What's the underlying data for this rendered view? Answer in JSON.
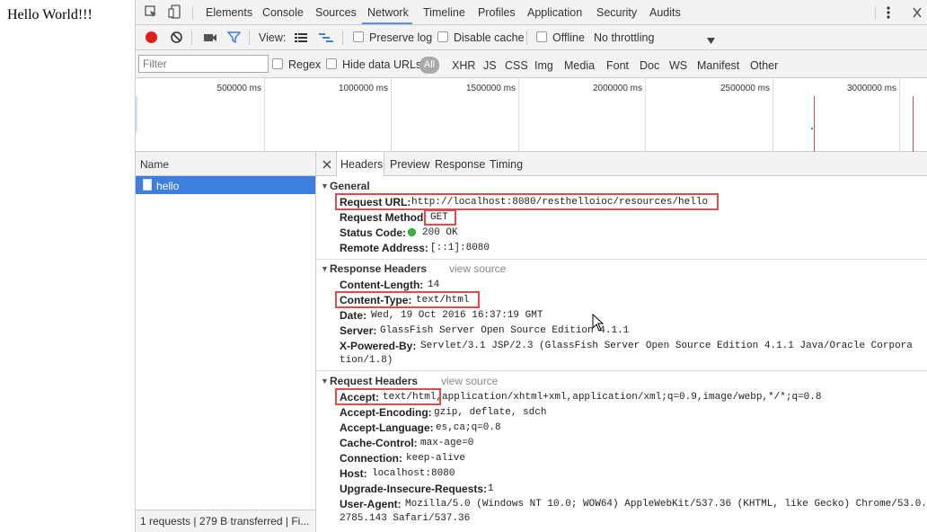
{
  "page": {
    "text": "Hello World!!!"
  },
  "devtools": {
    "tabs": [
      "Elements",
      "Console",
      "Sources",
      "Network",
      "Timeline",
      "Profiles",
      "Application",
      "Security",
      "Audits"
    ],
    "active_tab": "Network",
    "toolbar": {
      "view_label": "View:",
      "preserve_log": "Preserve log",
      "disable_cache": "Disable cache",
      "offline": "Offline",
      "throttle": "No throttling"
    },
    "filter": {
      "placeholder": "Filter",
      "regex": "Regex",
      "hide_data_urls": "Hide data URLs",
      "all": "All",
      "types": [
        "XHR",
        "JS",
        "CSS",
        "Img",
        "Media",
        "Font",
        "Doc",
        "WS",
        "Manifest",
        "Other"
      ]
    },
    "overview_ticks": [
      "500000 ms",
      "1000000 ms",
      "1500000 ms",
      "2000000 ms",
      "2500000 ms",
      "3000000 ms"
    ],
    "requests": {
      "column": "Name",
      "items": [
        "hello"
      ],
      "status": "1 requests  |  279 B transferred  |  Fi..."
    },
    "detail": {
      "tabs": [
        "Headers",
        "Preview",
        "Response",
        "Timing"
      ],
      "active_tab": "Headers",
      "general": {
        "title": "General",
        "rows": [
          {
            "k": "Request URL:",
            "v": "http://localhost:8080/resthelloioc/resources/hello"
          },
          {
            "k": "Request Method:",
            "v": "GET"
          },
          {
            "k": "Status Code:",
            "v": "200 OK"
          },
          {
            "k": "Remote Address:",
            "v": "[::1]:8080"
          }
        ]
      },
      "response_headers": {
        "title": "Response Headers",
        "view_source": "view source",
        "rows": [
          {
            "k": "Content-Length:",
            "v": "14"
          },
          {
            "k": "Content-Type:",
            "v": "text/html"
          },
          {
            "k": "Date:",
            "v": "Wed, 19 Oct 2016 16:37:19 GMT"
          },
          {
            "k": "Server:",
            "v": "GlassFish Server Open Source Edition  4.1.1"
          },
          {
            "k": "X-Powered-By:",
            "v": "Servlet/3.1 JSP/2.3 (GlassFish Server Open Source Edition  4.1.1  Java/Oracle Corpora",
            "v2": "tion/1.8)"
          }
        ]
      },
      "request_headers": {
        "title": "Request Headers",
        "view_source": "view source",
        "rows": [
          {
            "k": "Accept:",
            "v": "text/html,application/xhtml+xml,application/xml;q=0.9,image/webp,*/*;q=0.8"
          },
          {
            "k": "Accept-Encoding:",
            "v": "gzip, deflate, sdch"
          },
          {
            "k": "Accept-Language:",
            "v": "es,ca;q=0.8"
          },
          {
            "k": "Cache-Control:",
            "v": "max-age=0"
          },
          {
            "k": "Connection:",
            "v": "keep-alive"
          },
          {
            "k": "Host:",
            "v": "localhost:8080"
          },
          {
            "k": "Upgrade-Insecure-Requests:",
            "v": "1"
          },
          {
            "k": "User-Agent:",
            "v": "Mozilla/5.0 (Windows NT 10.0; WOW64) AppleWebKit/537.36 (KHTML, like Gecko) Chrome/53.0.",
            "v2": "2785.143 Safari/537.36"
          }
        ]
      }
    },
    "colors": {
      "accent": "#3d7fde",
      "highlight": "#e24b4b",
      "record": "#e0201a",
      "status_ok": "#3cb544"
    }
  }
}
